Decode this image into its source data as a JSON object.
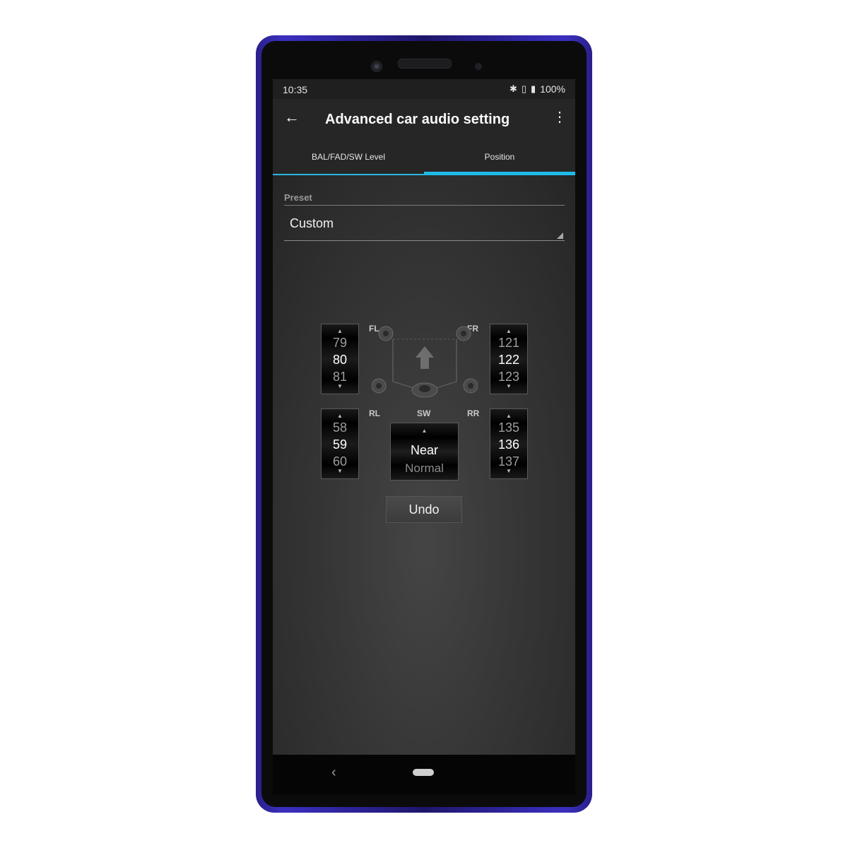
{
  "status_bar": {
    "time": "10:35",
    "battery": "100%",
    "icons": [
      "bluetooth-icon",
      "vibrate-icon",
      "battery-icon"
    ]
  },
  "app_bar": {
    "title": "Advanced car audio setting",
    "back_icon": "arrow-left-icon",
    "menu_icon": "more-vert-icon"
  },
  "tabs": [
    {
      "label": "BAL/FAD/SW Level",
      "selected": false
    },
    {
      "label": "Position",
      "selected": true
    }
  ],
  "accent_color": "#1ebbe9",
  "preset": {
    "label": "Preset",
    "value": "Custom"
  },
  "speakers": {
    "FL": {
      "label": "FL",
      "values": [
        "79",
        "80",
        "81"
      ]
    },
    "FR": {
      "label": "FR",
      "values": [
        "121",
        "122",
        "123"
      ]
    },
    "RL": {
      "label": "RL",
      "values": [
        "58",
        "59",
        "60"
      ]
    },
    "RR": {
      "label": "RR",
      "values": [
        "135",
        "136",
        "137"
      ]
    },
    "SW": {
      "label": "SW",
      "values": [
        "Near",
        "Normal"
      ]
    }
  },
  "undo_label": "Undo"
}
